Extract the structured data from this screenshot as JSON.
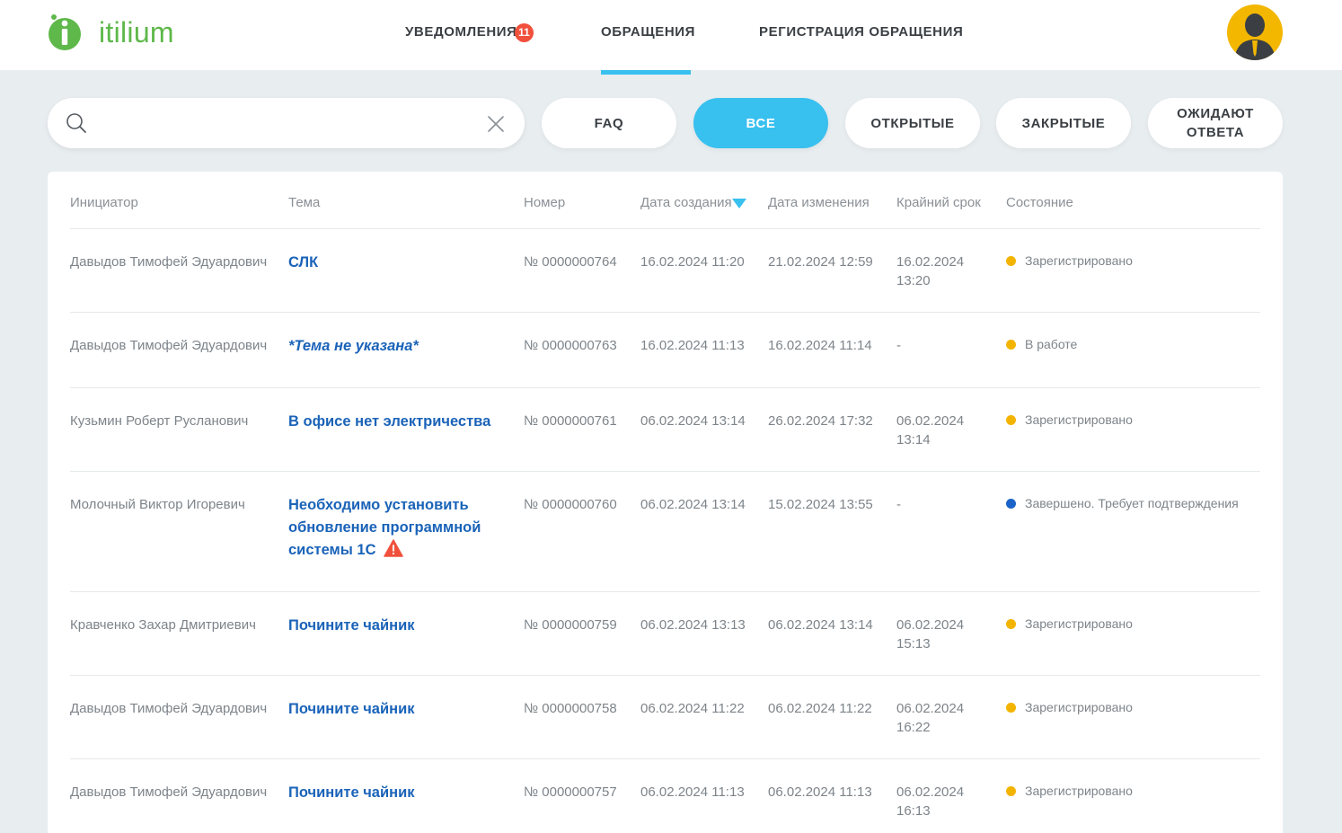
{
  "brand": {
    "name": "itilium",
    "color": "#5eb84a",
    "logo_icon": "info-i-logo-icon"
  },
  "nav": {
    "notifications_label": "УВЕДОМЛЕНИЯ",
    "notifications_count": "11",
    "appeals_label": "ОБРАЩЕНИЯ",
    "register_label": "РЕГИСТРАЦИЯ ОБРАЩЕНИЯ",
    "active": "ОБРАЩЕНИЯ",
    "accent_color": "#38c0ef",
    "avatar_icon": "user-silhouette-icon"
  },
  "search": {
    "value": "",
    "placeholder": ""
  },
  "filters": {
    "faq": "FAQ",
    "all": "ВСЕ",
    "open": "ОТКРЫТЫЕ",
    "closed": "ЗАКРЫТЫЕ",
    "waiting_line1": "ОЖИДАЮТ",
    "waiting_line2": "ОТВЕТА",
    "active": "ВСЕ"
  },
  "table": {
    "headers": {
      "initiator": "Инициатор",
      "topic": "Тема",
      "number": "Номер",
      "created": "Дата создания",
      "changed": "Дата изменения",
      "deadline": "Крайний срок",
      "state": "Состояние"
    },
    "sort": {
      "column": "Дата создания",
      "direction": "desc"
    },
    "status_colors": {
      "Зарегистрировано": "#f3b400",
      "В работе": "#f3b400",
      "Завершено. Требует подтверждения": "#1a63c8"
    },
    "rows": [
      {
        "initiator": "Давыдов Тимофей Эдуардович",
        "topic": "СЛК",
        "number": "№ 0000000764",
        "created": "16.02.2024 11:20",
        "changed": "21.02.2024 12:59",
        "deadline": "16.02.2024 13:20",
        "state": "Зарегистрировано"
      },
      {
        "initiator": "Давыдов Тимофей Эдуардович",
        "topic": "*Тема не указана*",
        "number": "№ 0000000763",
        "created": "16.02.2024 11:13",
        "changed": "16.02.2024 11:14",
        "deadline": "-",
        "state": "В работе"
      },
      {
        "initiator": "Кузьмин Роберт Русланович",
        "topic": "В офисе нет электричества",
        "number": "№ 0000000761",
        "created": "06.02.2024 13:14",
        "changed": "26.02.2024 17:32",
        "deadline": "06.02.2024 13:14",
        "state": "Зарегистрировано"
      },
      {
        "initiator": "Молочный Виктор Игоревич",
        "topic": "Необходимо установить обновление программной системы 1С",
        "number": "№ 0000000760",
        "created": "06.02.2024 13:14",
        "changed": "15.02.2024 13:55",
        "deadline": "-",
        "state": "Завершено. Требует подтверждения",
        "warning_icon": "warning-triangle-icon"
      },
      {
        "initiator": "Кравченко Захар Дмитриевич",
        "topic": "Почините чайник",
        "number": "№ 0000000759",
        "created": "06.02.2024 13:13",
        "changed": "06.02.2024 13:14",
        "deadline": "06.02.2024 15:13",
        "state": "Зарегистрировано"
      },
      {
        "initiator": "Давыдов Тимофей Эдуардович",
        "topic": "Почините чайник",
        "number": "№ 0000000758",
        "created": "06.02.2024 11:22",
        "changed": "06.02.2024 11:22",
        "deadline": "06.02.2024 16:22",
        "state": "Зарегистрировано"
      },
      {
        "initiator": "Давыдов Тимофей Эдуардович",
        "topic": "Почините чайник",
        "number": "№ 0000000757",
        "created": "06.02.2024 11:13",
        "changed": "06.02.2024 11:13",
        "deadline": "06.02.2024 16:13",
        "state": "Зарегистрировано"
      }
    ]
  }
}
